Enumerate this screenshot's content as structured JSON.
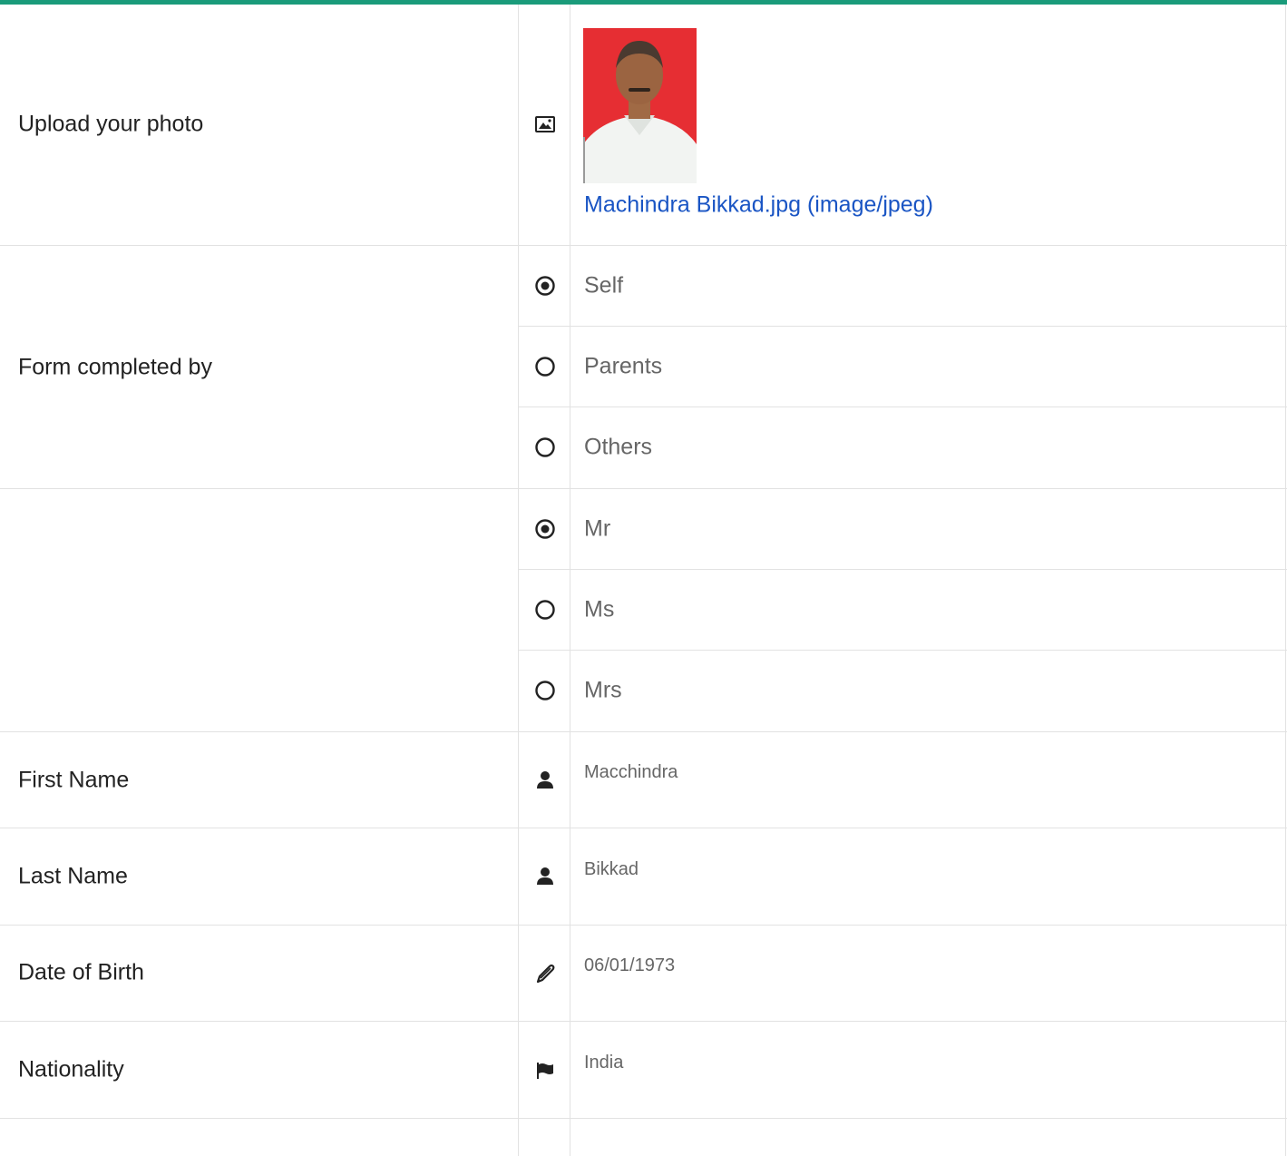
{
  "photo_row": {
    "label": "Upload your photo",
    "icon": "image-icon",
    "file_link": "Machindra Bikkad.jpg (image/jpeg)"
  },
  "completed_by": {
    "label": "Form completed by",
    "options": [
      {
        "label": "Self",
        "selected": true
      },
      {
        "label": "Parents",
        "selected": false
      },
      {
        "label": "Others",
        "selected": false
      }
    ]
  },
  "title": {
    "label": "",
    "options": [
      {
        "label": "Mr",
        "selected": true
      },
      {
        "label": "Ms",
        "selected": false
      },
      {
        "label": "Mrs",
        "selected": false
      }
    ]
  },
  "first_name": {
    "label": "First Name",
    "value": "Macchindra",
    "icon": "user-icon"
  },
  "last_name": {
    "label": "Last Name",
    "value": "Bikkad",
    "icon": "user-icon"
  },
  "dob": {
    "label": "Date of Birth",
    "value": "06/01/1973",
    "icon": "pen-icon"
  },
  "nationality": {
    "label": "Nationality",
    "value": "India",
    "icon": "flag-icon"
  },
  "colors": {
    "accent": "#1a9b7a",
    "link": "#1a55c4",
    "border": "#e2e2e2",
    "photo_bg": "#e62e33"
  }
}
